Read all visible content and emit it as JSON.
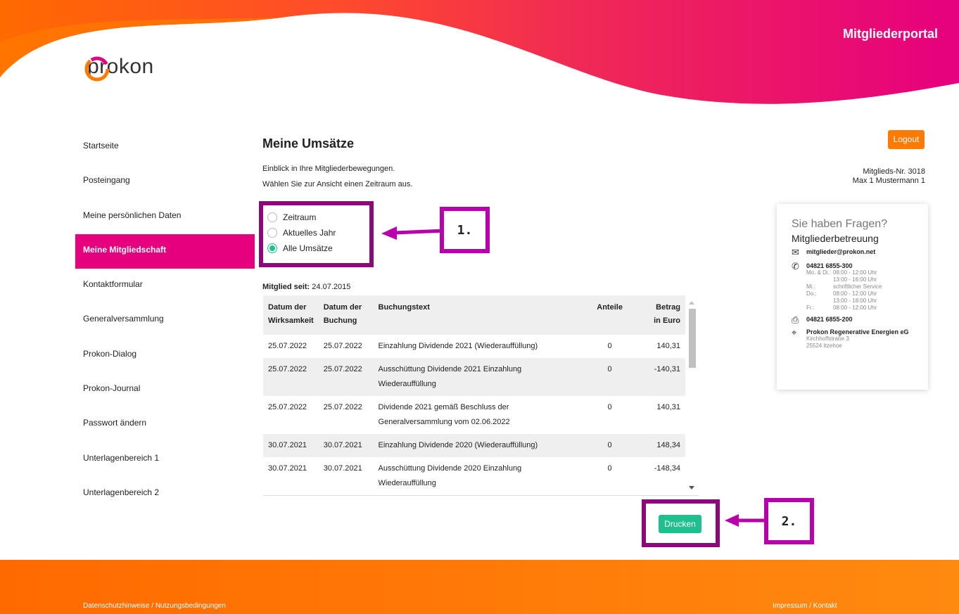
{
  "header": {
    "portal_title": "Mitgliederportal",
    "logo_text": "prokon"
  },
  "sidebar": {
    "items": [
      {
        "label": "Startseite",
        "active": false
      },
      {
        "label": "Posteingang",
        "active": false
      },
      {
        "label": "Meine persönlichen Daten",
        "active": false
      },
      {
        "label": "Meine Mitgliedschaft",
        "active": true
      },
      {
        "label": "Kontaktformular",
        "active": false
      },
      {
        "label": "Generalversammlung",
        "active": false
      },
      {
        "label": "Prokon-Dialog",
        "active": false
      },
      {
        "label": "Prokon-Journal",
        "active": false
      },
      {
        "label": "Passwort ändern",
        "active": false
      },
      {
        "label": "Unterlagenbereich 1",
        "active": false
      },
      {
        "label": "Unterlagenbereich 2",
        "active": false
      }
    ]
  },
  "main": {
    "title": "Meine Umsätze",
    "intro_line1": "Einblick in Ihre Mitgliederbewegungen.",
    "intro_line2": "Wählen Sie zur Ansicht einen Zeitraum aus.",
    "radio_options": [
      {
        "label": "Zeitraum",
        "checked": false
      },
      {
        "label": "Aktuelles Jahr",
        "checked": false
      },
      {
        "label": "Alle Umsätze",
        "checked": true
      }
    ],
    "member_since_label": "Mitglied seit:",
    "member_since_value": "24.07.2015",
    "table": {
      "headers": {
        "wirk_1": "Datum der",
        "wirk_2": "Wirksamkeit",
        "buch_1": "Datum der",
        "buch_2": "Buchung",
        "text": "Buchungstext",
        "anteile": "Anteile",
        "betrag_1": "Betrag",
        "betrag_2": "in Euro"
      },
      "rows": [
        {
          "wirksamkeit": "25.07.2022",
          "buchung": "25.07.2022",
          "text": "Einzahlung Dividende 2021 (Wiederauffüllung)",
          "anteile": "0",
          "betrag": "140,31"
        },
        {
          "wirksamkeit": "25.07.2022",
          "buchung": "25.07.2022",
          "text": "Ausschüttung Dividende 2021 Einzahlung Wiederauffüllung",
          "anteile": "0",
          "betrag": "-140,31"
        },
        {
          "wirksamkeit": "25.07.2022",
          "buchung": "25.07.2022",
          "text": "Dividende 2021 gemäß Beschluss der Generalversammlung vom 02.06.2022",
          "anteile": "0",
          "betrag": "140,31"
        },
        {
          "wirksamkeit": "30.07.2021",
          "buchung": "30.07.2021",
          "text": "Einzahlung Dividende 2020 (Wiederauffüllung)",
          "anteile": "0",
          "betrag": "148,34"
        },
        {
          "wirksamkeit": "30.07.2021",
          "buchung": "30.07.2021",
          "text": "Ausschüttung Dividende 2020 Einzahlung Wiederauffüllung",
          "anteile": "0",
          "betrag": "-148,34"
        }
      ]
    },
    "print_label": "Drucken"
  },
  "annotations": {
    "label_1": "1.",
    "label_2": "2."
  },
  "right": {
    "logout_label": "Logout",
    "member_no": "Mitglieds-Nr. 3018",
    "member_name": "Max 1 Mustermann 1",
    "help": {
      "question": "Sie haben Fragen?",
      "title": "Mitgliederbetreuung",
      "email": "mitglieder@prokon.net",
      "phone": "04821 6855-300",
      "hours": [
        [
          "Mo. & Di.:",
          "08:00 - 12:00 Uhr"
        ],
        [
          "",
          "13:00 - 16:00 Uhr"
        ],
        [
          "Mi.:",
          "schriftlicher Service"
        ],
        [
          "Do.:",
          "08:00 - 12:00 Uhr"
        ],
        [
          "",
          "13:00 - 18:00 Uhr"
        ],
        [
          "Fr.:",
          "08:00 - 12:00 Uhr"
        ]
      ],
      "fax": "04821 6855-200",
      "company": "Prokon Regenerative Energien eG",
      "street": "Kirchhoffstraße 3",
      "city": "25524 Itzehoe"
    }
  },
  "footer": {
    "left": "Datenschutzhinweise / Nutzungsbedingungen",
    "right": "Impressum / Kontakt"
  },
  "colors": {
    "accent": "#e6007e",
    "orange": "#ff7a00",
    "green": "#1fbf8f",
    "annotation": "#8b0a7a"
  }
}
